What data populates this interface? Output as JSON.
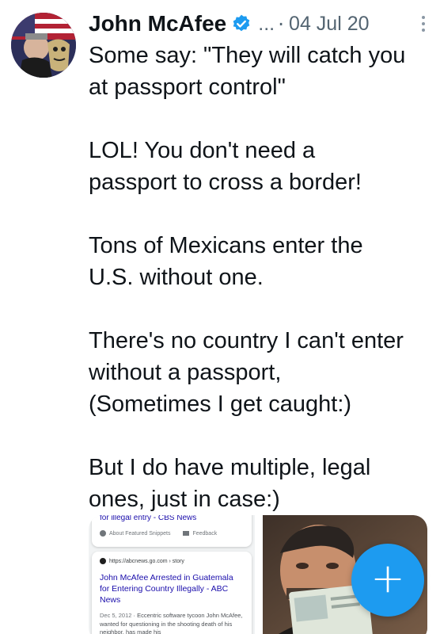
{
  "tweet": {
    "author_name": "John McAfee",
    "handle_truncated": "...",
    "separator": "·",
    "date": "04 Jul 20",
    "paragraphs": [
      "Some say: \"They will catch you\nat passport control\"",
      "LOL! You don't need a\npassport to cross a border!",
      "Tons of Mexicans enter the\nU.S. without one.",
      "There's no country I can't enter\nwithout a passport,\n(Sometimes I get caught:)",
      "But I do have multiple, legal\nones, just in case:)"
    ]
  },
  "media": {
    "search_screenshot": {
      "top_card_title": "for illegal entry - CBS News",
      "about_snippets": "About Featured Snippets",
      "feedback": "Feedback",
      "source_url": "https://abcnews.go.com › story",
      "result_title": "John McAfee Arrested in Guatemala for Entering Country Illegally - ABC News",
      "result_date": "Dec 5, 2012",
      "result_snippet": "· Eccentric software tycoon John McAfee, wanted for questioning in the shooting death of his neighbor, has made his"
    }
  },
  "fab": {
    "icon": "plus-icon",
    "symbol": "+"
  },
  "colors": {
    "accent": "#1d9bf0",
    "text": "#0f1419",
    "secondary": "#536471"
  }
}
